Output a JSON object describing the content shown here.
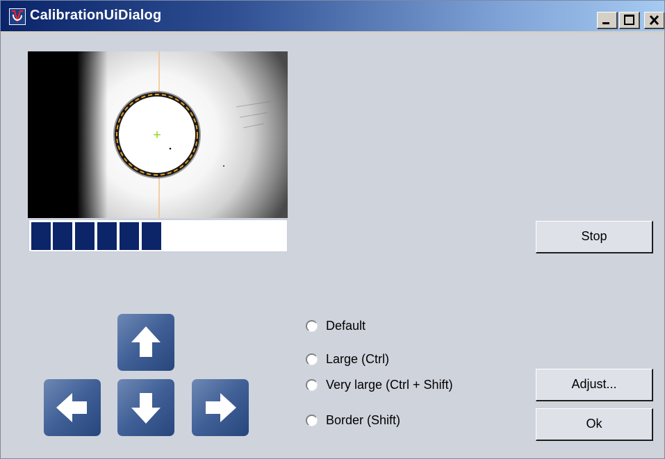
{
  "window": {
    "title": "CalibrationUiDialog"
  },
  "camera": {
    "progress_fraction": 0.53
  },
  "buttons": {
    "stop": "Stop",
    "adjust": "Adjust...",
    "ok": "Ok"
  },
  "zoom_options": [
    {
      "label": "Default",
      "selected": false
    },
    {
      "label": "Large (Ctrl)",
      "selected": false
    },
    {
      "label": "Very large (Ctrl + Shift)",
      "selected": false
    },
    {
      "label": "Border (Shift)",
      "selected": false
    }
  ],
  "icons": {
    "window": "app-logo-icon",
    "minimize": "minimize-icon",
    "maximize": "maximize-icon",
    "close": "close-icon",
    "up": "arrow-up-icon",
    "down": "arrow-down-icon",
    "left": "arrow-left-icon",
    "right": "arrow-right-icon"
  },
  "colors": {
    "title_bar_start": "#0a246a",
    "title_bar_end": "#a6caf0",
    "progress_block": "#0c2568",
    "arrow_button": "#3f5f96",
    "circle_marker": "#e8a020"
  }
}
